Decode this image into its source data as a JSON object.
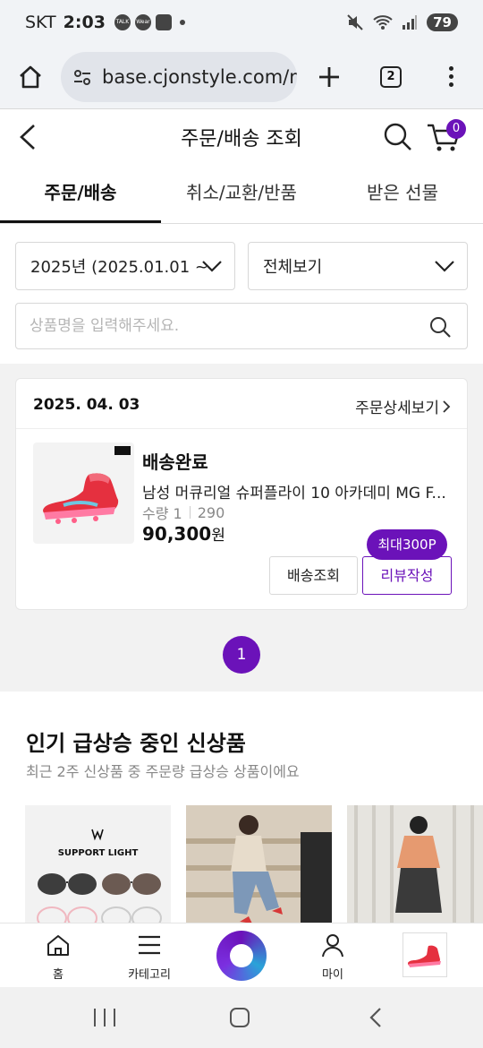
{
  "status_bar": {
    "carrier": "SKT",
    "time": "2:03",
    "battery": "79",
    "notification_icons": [
      "talk-icon",
      "wear-icon",
      "app-icon"
    ]
  },
  "browser": {
    "url": "base.cjonstyle.com/m",
    "tab_count": "2"
  },
  "header": {
    "title": "주문/배송 조회",
    "cart_count": "0"
  },
  "tabs": [
    {
      "label": "주문/배송",
      "active": true
    },
    {
      "label": "취소/교환/반품",
      "active": false
    },
    {
      "label": "받은 선물",
      "active": false
    }
  ],
  "filters": {
    "period_value": "2025년 (2025.01.01 ~",
    "type_value": "전체보기",
    "search_placeholder": "상품명을 입력해주세요."
  },
  "order": {
    "date": "2025. 04. 03",
    "detail_link": "주문상세보기",
    "status": "배송완료",
    "product_name": "남성 머큐리얼 슈퍼플라이 10 아카데미 MG F...",
    "quantity": "수량 1",
    "option": "290",
    "price": "90,300",
    "price_unit": "원",
    "track_button": "배송조회",
    "review_button": "리뷰작성",
    "reward_tag": "최대300P"
  },
  "pagination": {
    "current": "1"
  },
  "recommendations": {
    "title": "인기 급상승 중인 신상품",
    "subtitle": "최근 2주 신상품 중 주문량 급상승 상품이에요",
    "card1_brand": "SUPPORT LIGHT"
  },
  "bottom_nav": {
    "home": "홈",
    "category": "카테고리",
    "my": "마이"
  },
  "colors": {
    "accent": "#6b12b9",
    "product_red": "#e5303f"
  }
}
